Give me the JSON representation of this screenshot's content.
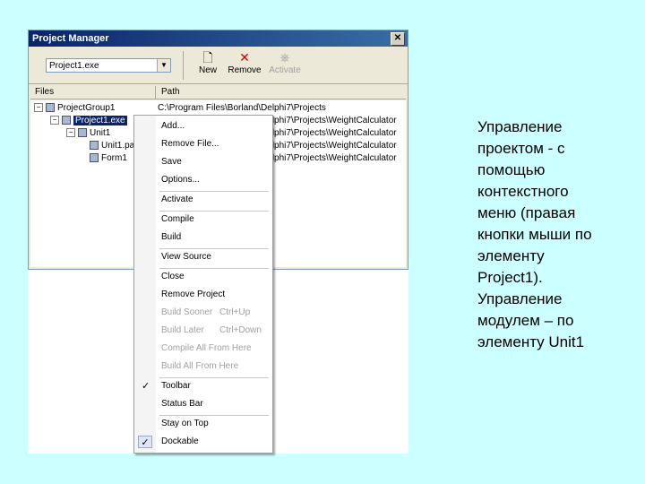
{
  "window": {
    "title": "Project Manager"
  },
  "toolbar": {
    "combo_value": "Project1.exe",
    "new_label": "New",
    "remove_label": "Remove",
    "activate_label": "Activate"
  },
  "columns": {
    "files": "Files",
    "path": "Path"
  },
  "tree": {
    "group": {
      "name": "ProjectGroup1",
      "path": "C:\\Program Files\\Borland\\Delphi7\\Projects"
    },
    "project": {
      "name": "Project1.exe",
      "path": "C:\\Program Files\\Borland\\Delphi7\\Projects\\WeightCalculator"
    },
    "unit1": {
      "name": "Unit1",
      "path": "C:\\Program Files\\Borland\\Delphi7\\Projects\\WeightCalculator"
    },
    "unit1_file": {
      "name": "Unit1.pas",
      "path": "C:\\Program Files\\Borland\\Delphi7\\Projects\\WeightCalculator"
    },
    "form1": {
      "name": "Form1",
      "path": "C:\\Program Files\\Borland\\Delphi7\\Projects\\WeightCalculator"
    }
  },
  "menu": {
    "items": [
      {
        "label": "Add...",
        "enabled": true
      },
      {
        "label": "Remove File...",
        "enabled": true
      },
      {
        "label": "Save",
        "enabled": true
      },
      {
        "label": "Options...",
        "enabled": true
      },
      {
        "label": "Activate",
        "enabled": true
      },
      {
        "label": "Compile",
        "enabled": true
      },
      {
        "label": "Build",
        "enabled": true
      },
      {
        "label": "View Source",
        "enabled": true
      },
      {
        "label": "Close",
        "enabled": true
      },
      {
        "label": "Remove Project",
        "enabled": true
      },
      {
        "label": "Build Sooner",
        "shortcut": "Ctrl+Up",
        "enabled": false
      },
      {
        "label": "Build Later",
        "shortcut": "Ctrl+Down",
        "enabled": false
      },
      {
        "label": "Compile All From Here",
        "enabled": false
      },
      {
        "label": "Build All From Here",
        "enabled": false
      },
      {
        "label": "Toolbar",
        "checked": true,
        "enabled": true
      },
      {
        "label": "Status Bar",
        "checked": false,
        "enabled": true
      },
      {
        "label": "Stay on Top",
        "enabled": true
      },
      {
        "label": "Dockable",
        "checked": true,
        "enabled": true
      }
    ]
  },
  "description": {
    "lines": [
      "Управление",
      "проектом - с",
      "помощью",
      "контекстного",
      "меню (правая",
      "кнопки мыши по",
      "элементу",
      "Project1).",
      "Управление",
      "модулем – по",
      "элементу Unit1"
    ]
  },
  "colors": {
    "slide_background": "#ccffff",
    "titlebar": "#0a246a",
    "selection": "#0a246a"
  }
}
